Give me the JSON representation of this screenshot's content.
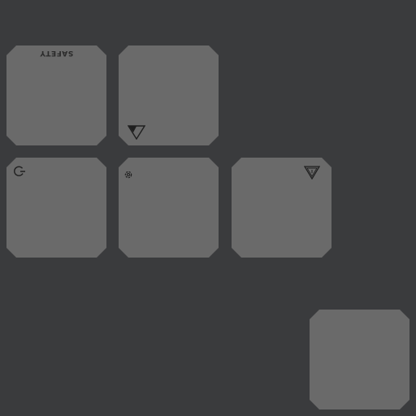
{
  "tiles": [
    {
      "id": "t1",
      "label": "SAFETY",
      "icon": null
    },
    {
      "id": "t2",
      "label": "",
      "icon": "warning-triangle-down-icon"
    },
    {
      "id": "t3",
      "label": "",
      "icon": "refresh-circle-icon"
    },
    {
      "id": "t4",
      "label": "",
      "icon": "gear-icon"
    },
    {
      "id": "t5",
      "label": "",
      "icon": "hazard-triangle-icon"
    },
    {
      "id": "t6",
      "label": "",
      "icon": null
    }
  ],
  "colors": {
    "background": "#3a3b3d",
    "tile": "#6a6a6a",
    "icon": "#1f1f1f"
  }
}
